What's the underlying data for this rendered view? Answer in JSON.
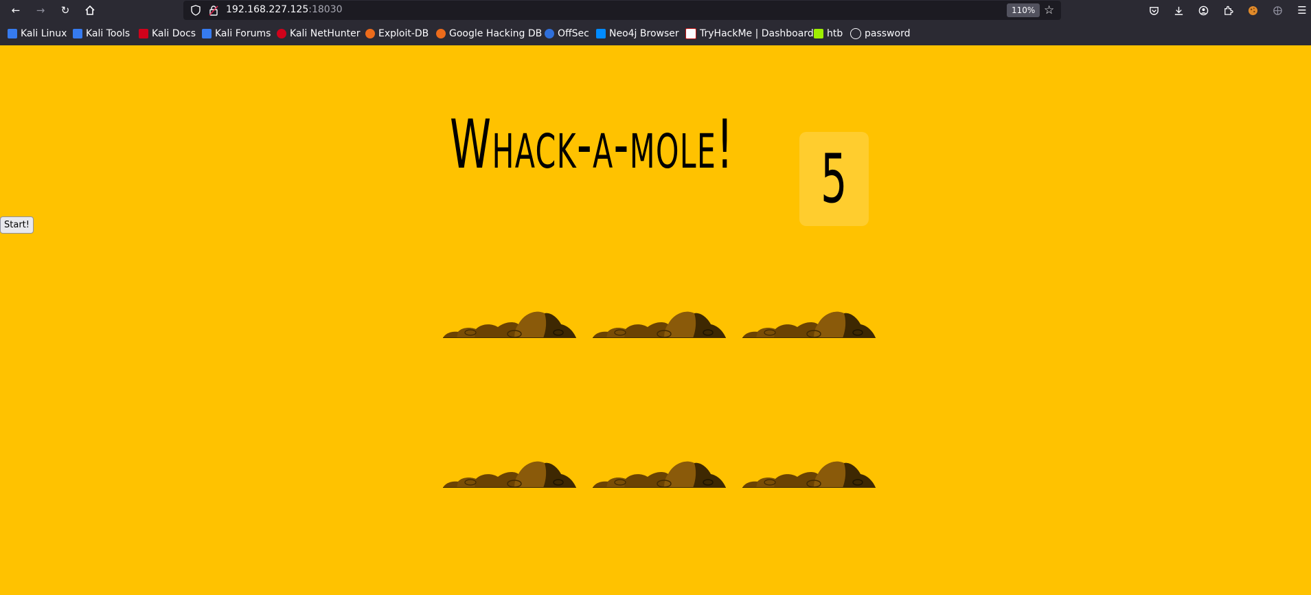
{
  "browser": {
    "url_host": "192.168.227.125",
    "url_port": ":18030",
    "zoom": "110%",
    "bookmarks": [
      {
        "label": "Kali Linux",
        "icon": "kali-dragon-icon",
        "color": "#367bf0"
      },
      {
        "label": "Kali Tools",
        "icon": "kali-tools-icon",
        "color": "#367bf0"
      },
      {
        "label": "Kali Docs",
        "icon": "kali-docs-icon",
        "color": "#d0021b"
      },
      {
        "label": "Kali Forums",
        "icon": "kali-dragon-icon",
        "color": "#367bf0"
      },
      {
        "label": "Kali NetHunter",
        "icon": "nethunter-icon",
        "color": "#d0021b"
      },
      {
        "label": "Exploit-DB",
        "icon": "exploit-db-icon",
        "color": "#ec6b1b"
      },
      {
        "label": "Google Hacking DB",
        "icon": "exploit-db-icon",
        "color": "#ec6b1b"
      },
      {
        "label": "OffSec",
        "icon": "offsec-icon",
        "color": "#2f6fdb"
      },
      {
        "label": "Neo4j Browser",
        "icon": "terminal-icon",
        "color": "#018bff"
      },
      {
        "label": "TryHackMe | Dashboard",
        "icon": "tryhackme-icon",
        "color": "#c11111"
      },
      {
        "label": "htb",
        "icon": "htb-cube-icon",
        "color": "#9fef00"
      },
      {
        "label": "password",
        "icon": "globe-icon",
        "color": "#fbfbfe"
      }
    ]
  },
  "game": {
    "title": "Whack-a-mole!",
    "score": "5",
    "start_label": "Start!",
    "background": "#ffc200",
    "holes": 6
  }
}
